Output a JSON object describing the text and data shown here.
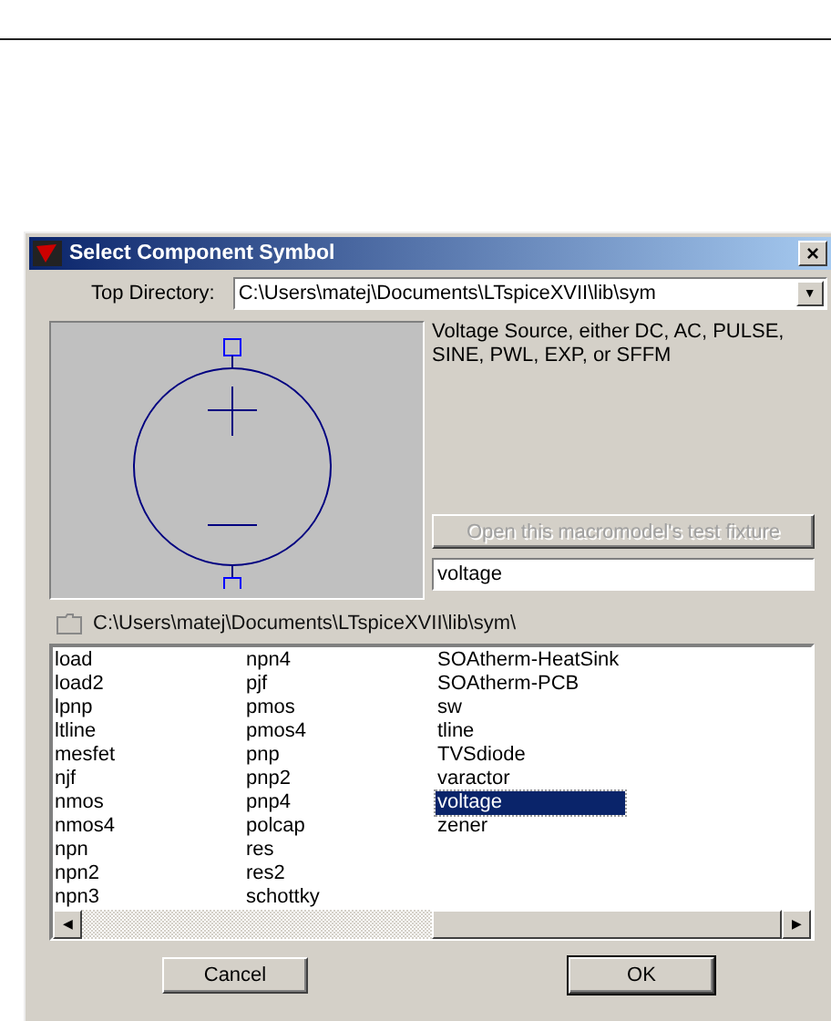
{
  "window": {
    "title": "Select Component Symbol",
    "close": "×"
  },
  "top_directory": {
    "label": "Top Directory:",
    "value": "C:\\Users\\matej\\Documents\\LTspiceXVII\\lib\\sym",
    "arrow": "▼"
  },
  "description": "Voltage Source, either DC, AC, PULSE, SINE, PWL, EXP, or SFFM",
  "test_fixture_button": {
    "label": "Open this macromodel's test fixture",
    "disabled": true
  },
  "name_field": {
    "value": "voltage"
  },
  "current_path": "C:\\Users\\matej\\Documents\\LTspiceXVII\\lib\\sym\\",
  "symbols": [
    {
      "name": "load",
      "selected": false
    },
    {
      "name": "load2",
      "selected": false
    },
    {
      "name": "lpnp",
      "selected": false
    },
    {
      "name": "ltline",
      "selected": false
    },
    {
      "name": "mesfet",
      "selected": false
    },
    {
      "name": "njf",
      "selected": false
    },
    {
      "name": "nmos",
      "selected": false
    },
    {
      "name": "nmos4",
      "selected": false
    },
    {
      "name": "npn",
      "selected": false
    },
    {
      "name": "npn2",
      "selected": false
    },
    {
      "name": "npn3",
      "selected": false
    },
    {
      "name": "npn4",
      "selected": false
    },
    {
      "name": "pjf",
      "selected": false
    },
    {
      "name": "pmos",
      "selected": false
    },
    {
      "name": "pmos4",
      "selected": false
    },
    {
      "name": "pnp",
      "selected": false
    },
    {
      "name": "pnp2",
      "selected": false
    },
    {
      "name": "pnp4",
      "selected": false
    },
    {
      "name": "polcap",
      "selected": false
    },
    {
      "name": "res",
      "selected": false
    },
    {
      "name": "res2",
      "selected": false
    },
    {
      "name": "schottky",
      "selected": false
    },
    {
      "name": "SOAtherm-HeatSink",
      "selected": false
    },
    {
      "name": "SOAtherm-PCB",
      "selected": false
    },
    {
      "name": "sw",
      "selected": false
    },
    {
      "name": "tline",
      "selected": false
    },
    {
      "name": "TVSdiode",
      "selected": false
    },
    {
      "name": "varactor",
      "selected": false
    },
    {
      "name": "voltage",
      "selected": true
    },
    {
      "name": "zener",
      "selected": false
    }
  ],
  "scrollbar": {
    "left": "◀",
    "right": "▶"
  },
  "buttons": [
    {
      "label": "Cancel",
      "default": false
    },
    {
      "label": "OK",
      "default": true
    }
  ]
}
